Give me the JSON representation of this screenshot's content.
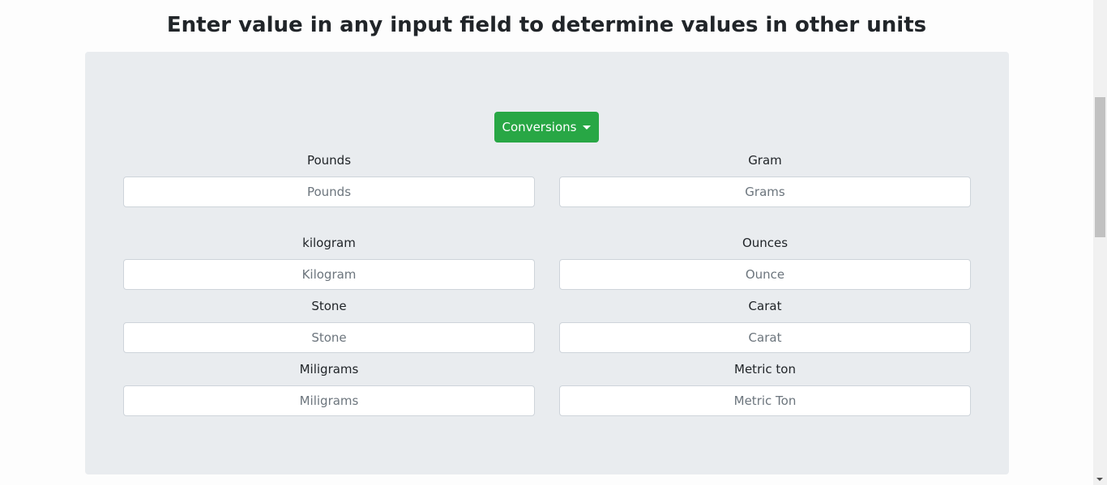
{
  "title": "Enter value in any input field to determine values in other units",
  "dropdown": {
    "label": "Conversions",
    "color": "#28a745"
  },
  "fields": [
    {
      "label": "Pounds",
      "placeholder": "Pounds"
    },
    {
      "label": "Gram",
      "placeholder": "Grams"
    },
    {
      "label": "kilogram",
      "placeholder": "Kilogram"
    },
    {
      "label": "Ounces",
      "placeholder": "Ounce"
    },
    {
      "label": "Stone",
      "placeholder": "Stone"
    },
    {
      "label": "Carat",
      "placeholder": "Carat"
    },
    {
      "label": "Miligrams",
      "placeholder": "Miligrams"
    },
    {
      "label": "Metric ton",
      "placeholder": "Metric Ton"
    }
  ]
}
